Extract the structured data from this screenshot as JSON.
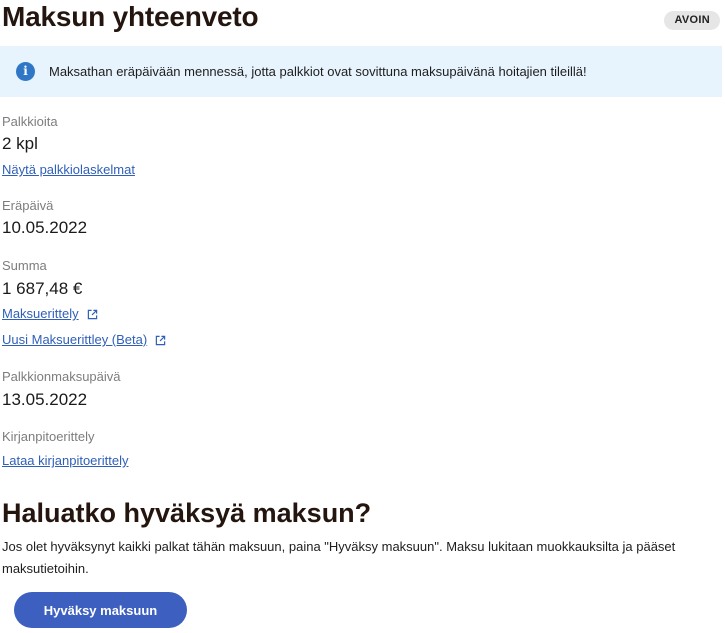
{
  "header": {
    "title": "Maksun yhteenveto",
    "status": "AVOIN"
  },
  "info": {
    "icon": "info-icon",
    "text": "Maksathan eräpäivään mennessä, jotta palkkiot ovat sovittuna maksupäivänä hoitajien tileillä!"
  },
  "fields": {
    "fees": {
      "label": "Palkkioita",
      "value": "2 kpl",
      "link": "Näytä palkkiolaskelmat"
    },
    "due_date": {
      "label": "Eräpäivä",
      "value": "10.05.2022"
    },
    "sum": {
      "label": "Summa",
      "value": "1 687,48 €",
      "link1": "Maksuerittely",
      "link2": "Uusi Maksuerittley (Beta)"
    },
    "payment_date": {
      "label": "Palkkionmaksupäivä",
      "value": "13.05.2022"
    },
    "accounting": {
      "label": "Kirjanpitoerittely",
      "link": "Lataa kirjanpitoerittely"
    }
  },
  "approval": {
    "title": "Haluatko hyväksyä maksun?",
    "description": "Jos olet hyväksynyt kaikki palkat tähän maksuun, paina \"Hyväksy maksuun\". Maksu lukitaan muokkauksilta ja pääset maksutietoihin.",
    "button": "Hyväksy maksuun"
  },
  "colors": {
    "accent": "#3d5fbf",
    "link": "#2f5fb8",
    "info_bg": "#e8f4fd",
    "info_icon": "#2f77c6",
    "badge_bg": "#e6e6e6"
  }
}
